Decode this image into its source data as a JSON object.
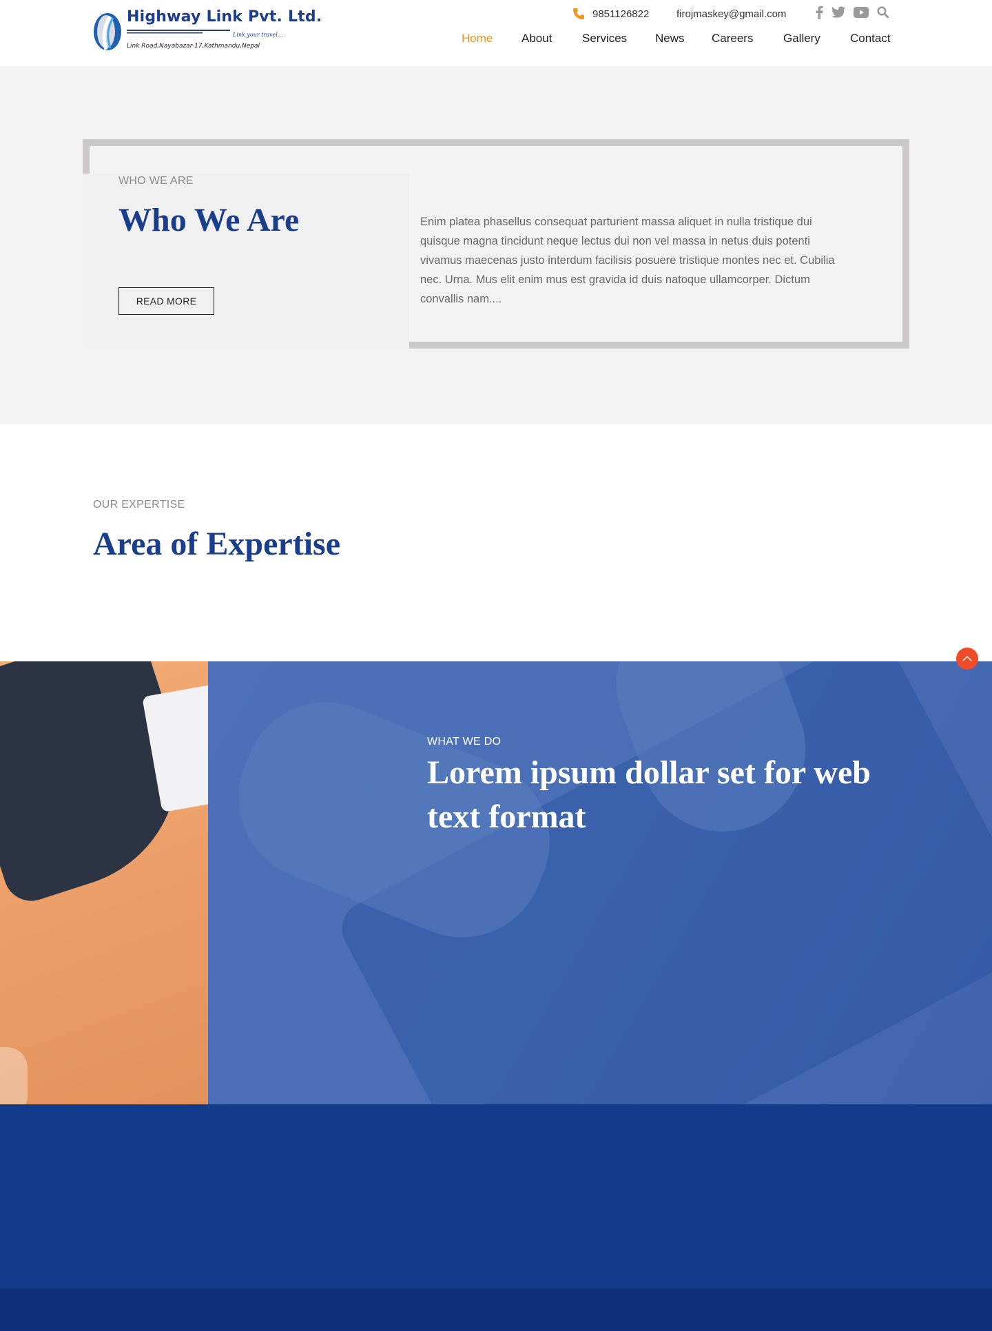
{
  "header": {
    "logo": {
      "title": "Highway Link Pvt. Ltd.",
      "tagline": "Link your travel...",
      "address": "Link Road,Nayabazar-17,Kathmandu,Nepal"
    },
    "contact": {
      "phone": "9851126822",
      "email": "firojmaskey@gmail.com"
    },
    "social_icons": [
      "facebook-icon",
      "twitter-icon",
      "youtube-icon",
      "search-icon"
    ],
    "nav": [
      {
        "label": "Home",
        "active": true
      },
      {
        "label": "About",
        "has_dropdown": true
      },
      {
        "label": "Services"
      },
      {
        "label": "News"
      },
      {
        "label": "Careers"
      },
      {
        "label": "Gallery",
        "has_dropdown": true
      },
      {
        "label": "Contact"
      }
    ]
  },
  "who": {
    "eyebrow": "WHO WE ARE",
    "title": "Who We Are",
    "button": "READ MORE",
    "body": "Enim platea phasellus consequat parturient massa aliquet in nulla tristique dui quisque magna tincidunt neque lectus dui non vel massa in netus duis potenti vivamus maecenas justo interdum facilisis posuere tristique montes nec et. Cubilia nec. Urna. Mus elit enim mus est gravida id duis natoque ullamcorper. Dictum convallis nam...."
  },
  "expertise": {
    "eyebrow": "OUR EXPERTISE",
    "title": "Area of Expertise"
  },
  "feature": {
    "eyebrow": "WHAT WE DO",
    "title": "Lorem ipsum dollar set for web text format"
  },
  "colors": {
    "accent": "#f0961c",
    "brand_blue": "#1a3e8c",
    "band_blue": "#133b8b",
    "band_dark": "#0e2f7a",
    "back_to_top": "#ee4b28"
  }
}
